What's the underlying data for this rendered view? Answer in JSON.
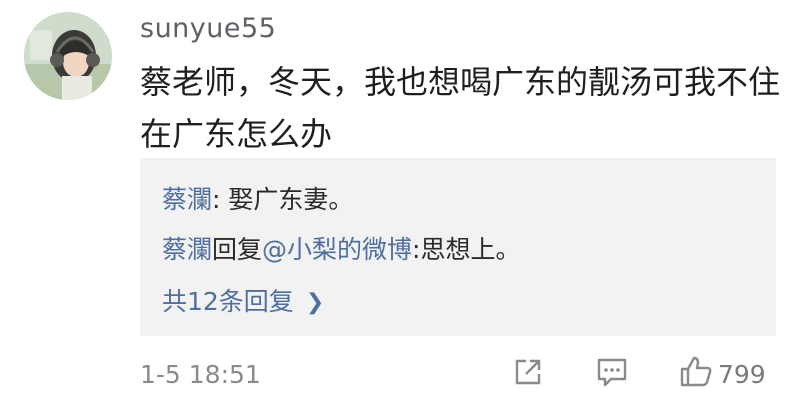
{
  "comment": {
    "username": "sunyue55",
    "text": "蔡老师，冬天，我也想喝广东的靓汤可我不住在广东怎么办",
    "avatar_icon": "anime-girl-headphones-avatar"
  },
  "replies": [
    {
      "author": "蔡瀾",
      "separator": ": ",
      "text": "娶广东妻。"
    },
    {
      "author": "蔡瀾",
      "verb": "回复",
      "mention": "@小梨的微博",
      "separator": ":",
      "text": "思想上。"
    }
  ],
  "reply_count_label": "共12条回复",
  "footer": {
    "timestamp": "1-5 18:51",
    "like_count": "799",
    "share_icon": "share-icon",
    "comment_icon": "comment-icon",
    "like_icon": "thumbs-up-icon"
  },
  "colors": {
    "link_blue": "#4f6f9e",
    "reply_bg": "#f2f2f2",
    "muted_gray": "#8a8a8a"
  }
}
